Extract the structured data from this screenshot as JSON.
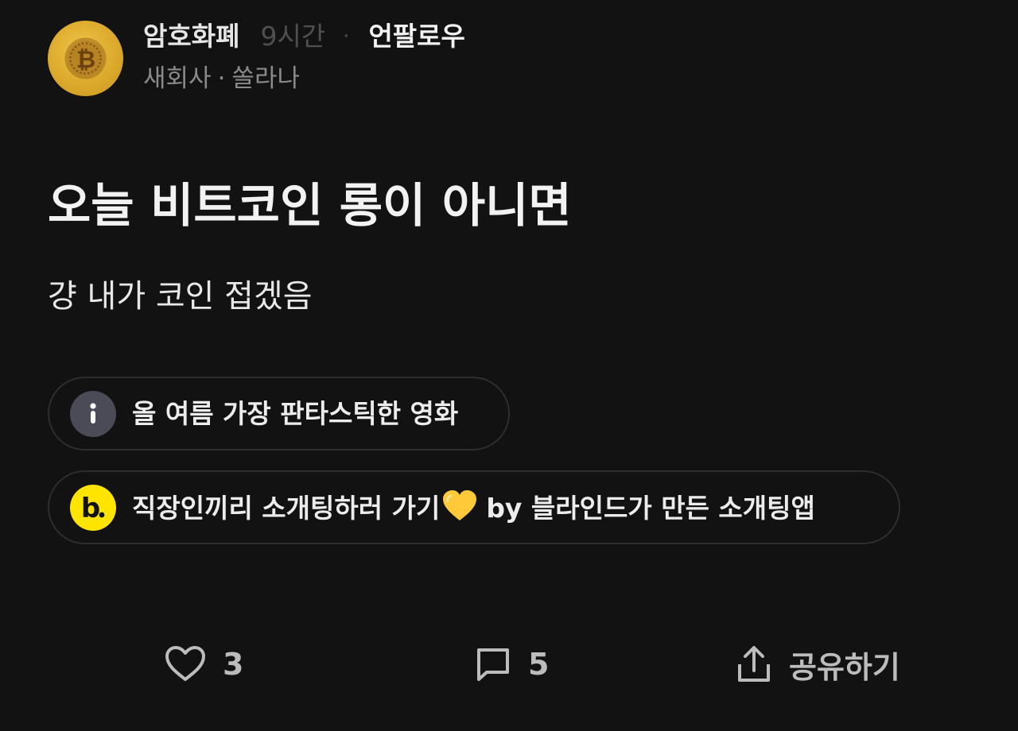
{
  "header": {
    "avatar_icon": "bitcoin-coin-icon",
    "channel": "암호화폐",
    "time_ago": "9시간",
    "separator": "·",
    "follow_action": "언팔로우",
    "company": "새회사",
    "company_separator": "·",
    "nickname": "쏠라나"
  },
  "post": {
    "title": "오늘 비트코인 롱이 아니면",
    "body": "걍 내가 코인 접겠음"
  },
  "ads": [
    {
      "icon": "info-icon",
      "text": "올 여름 가장 판타스틱한 영화"
    },
    {
      "icon": "blind-logo-icon",
      "text_before": "직장인끼리 소개팅하러 가기",
      "emoji": "yellow-heart-icon",
      "text_after": "by 블라인드가 만든 소개팅앱"
    }
  ],
  "actions": {
    "like": {
      "icon": "heart-outline-icon",
      "count": "3"
    },
    "comment": {
      "icon": "comment-icon",
      "count": "5"
    },
    "share": {
      "icon": "share-upload-icon",
      "label": "공유하기"
    }
  },
  "colors": {
    "background": "#121212",
    "avatar_gold": "#dcaa2c",
    "blind_yellow": "#ffe400",
    "info_circle": "#4b4a57",
    "muted_text": "#8a8a8a",
    "time_text": "#4f4f4f"
  }
}
